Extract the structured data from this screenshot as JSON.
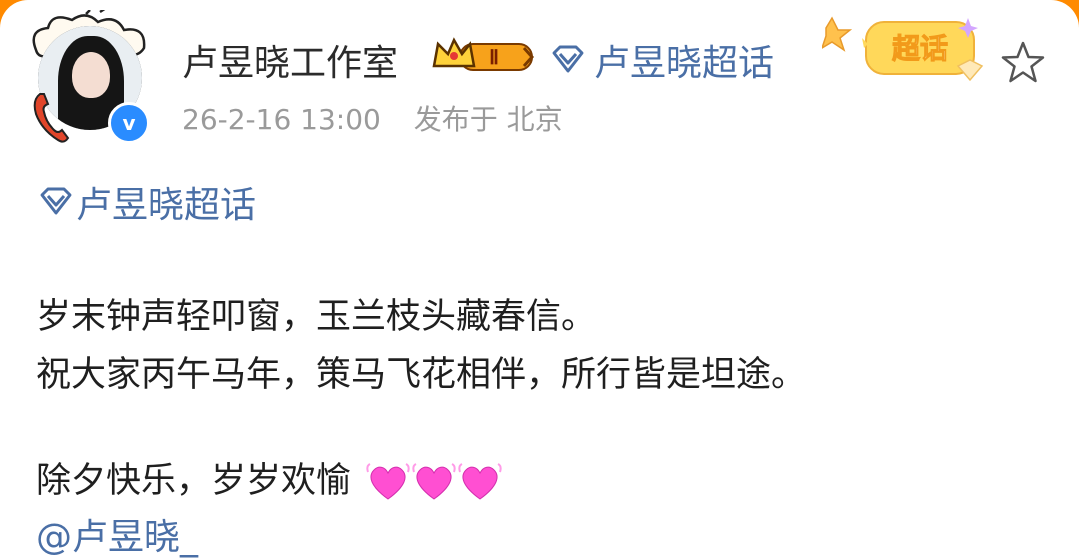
{
  "post": {
    "author": {
      "name": "卢昱晓工作室",
      "level_badge": "Ⅱ",
      "verified_mark": "v"
    },
    "supertopic_header": "卢昱晓超话",
    "timestamp": "26-2-16 13:00",
    "published_from": "发布于 北京",
    "sticker_label": "超话",
    "topic_tag": "卢昱晓超话",
    "lines": [
      "岁末钟声轻叩窗，玉兰枝头藏春信。",
      "祝大家丙午马年，策马飞花相伴，所行皆是坦途。",
      "除夕快乐，岁岁欢愉"
    ],
    "mention": "@卢昱晓_"
  },
  "colors": {
    "link_blue": "#4a6fa6",
    "text_dark": "#1f1f1f",
    "meta_gray": "#9a9a9a",
    "heart_pink": "#ff4fd2",
    "outer_orange": "#ff8a00"
  },
  "icons": [
    "diamond-icon",
    "crown-icon",
    "star-icon",
    "heart-icon"
  ]
}
